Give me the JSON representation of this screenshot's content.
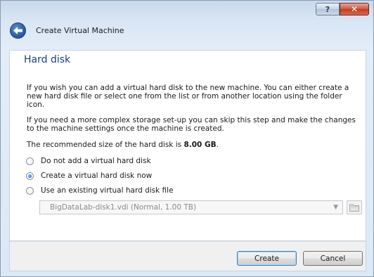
{
  "titlebar": {
    "help_label": "?",
    "close_label": "✕"
  },
  "header": {
    "title": "Create Virtual Machine"
  },
  "page": {
    "heading": "Hard disk",
    "para1": "If you wish you can add a virtual hard disk to the new machine. You can either create a new hard disk file or select one from the list or from another location using the folder icon.",
    "para2": "If you need a more complex storage set-up you can skip this step and make the changes to the machine settings once the machine is created.",
    "para3_prefix": "The recommended size of the hard disk is ",
    "para3_value": "8.00 GB",
    "para3_suffix": "."
  },
  "options": [
    {
      "label": "Do not add a virtual hard disk",
      "checked": false
    },
    {
      "label": "Create a virtual hard disk now",
      "checked": true
    },
    {
      "label": "Use an existing virtual hard disk file",
      "checked": false
    }
  ],
  "disk_select": {
    "value": "BigDataLab-disk1.vdi (Normal, 1.00 TB)"
  },
  "buttons": {
    "create": "Create",
    "cancel": "Cancel"
  },
  "icons": {
    "back": "back-arrow-icon",
    "folder": "folder-icon",
    "dropdown": "chevron-down-icon"
  }
}
